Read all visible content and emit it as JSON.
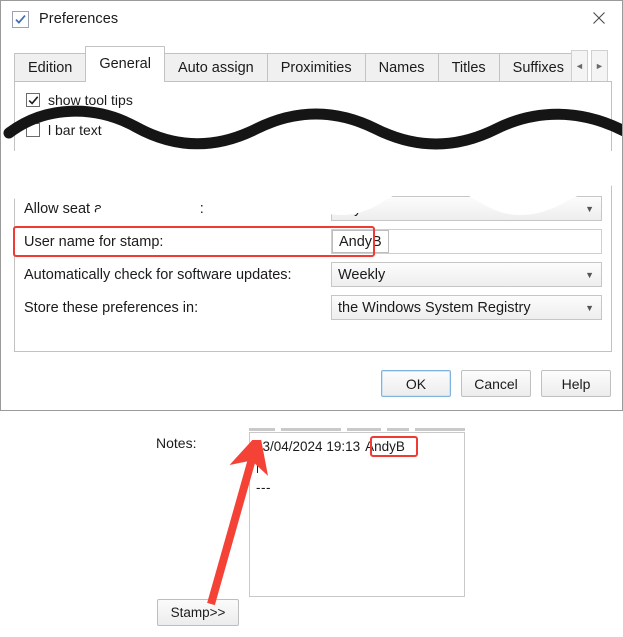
{
  "dialog": {
    "title": "Preferences",
    "icon": "checkbox-check-icon",
    "close_label": "✕",
    "tabs": [
      {
        "label": "Edition",
        "selected": false
      },
      {
        "label": "General",
        "selected": true
      },
      {
        "label": "Auto assign",
        "selected": false
      },
      {
        "label": "Proximities",
        "selected": false
      },
      {
        "label": "Names",
        "selected": false
      },
      {
        "label": "Titles",
        "selected": false
      },
      {
        "label": "Suffixes",
        "selected": false
      }
    ],
    "tab_nav": {
      "prev": "◄",
      "next": "►"
    },
    "checkboxes": [
      {
        "label": "show tool tips",
        "checked": true
      },
      {
        "label": "l bar text",
        "checked": false
      }
    ],
    "options": [
      {
        "label": "Allow seat a      ent with RSVP:",
        "value": "any",
        "control": "combo",
        "obscured": true
      },
      {
        "label": "User name for stamp:",
        "value": "AndyB",
        "control": "textbox",
        "highlighted": true
      },
      {
        "label": "Automatically check for software updates:",
        "value": "Weekly",
        "control": "combo"
      },
      {
        "label": "Store these preferences in:",
        "value": "the Windows System Registry",
        "control": "combo"
      }
    ],
    "buttons": [
      {
        "label": "OK",
        "default": true
      },
      {
        "label": "Cancel",
        "default": false
      },
      {
        "label": "Help",
        "default": false
      }
    ]
  },
  "notes": {
    "label": "Notes:",
    "stamp_date": "03/04/2024 19:13",
    "stamp_user": "AndyB",
    "separator": "---",
    "stamp_button_label": "Stamp>>"
  },
  "annotations": {
    "accent_color": "#f03b34",
    "highlight_username_row": "User name for stamp: AndyB",
    "highlight_stamp_user": "AndyB",
    "arrow": "stamp-button-to-note-date"
  }
}
